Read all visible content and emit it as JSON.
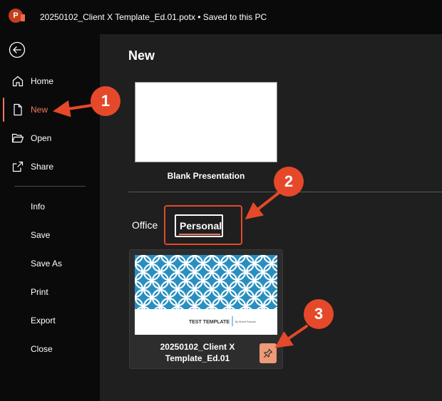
{
  "app": {
    "logo_letter": "P",
    "title": "20250102_Client X Template_Ed.01.potx  •  Saved to this PC"
  },
  "nav": {
    "primary": [
      {
        "label": "Home",
        "icon": "home-icon"
      },
      {
        "label": "New",
        "icon": "new-document-icon",
        "active": true
      },
      {
        "label": "Open",
        "icon": "folder-open-icon"
      },
      {
        "label": "Share",
        "icon": "share-icon"
      }
    ],
    "secondary": [
      "Info",
      "Save",
      "Save As",
      "Print",
      "Export",
      "Close"
    ]
  },
  "main": {
    "title": "New",
    "blank_label": "Blank Presentation",
    "tabs": {
      "office": "Office",
      "personal": "Personal"
    },
    "template": {
      "thumb_title": "TEST TEMPLATE",
      "thumb_sub": "By Sheriff Rowsan",
      "name_line1": "20250102_Client X",
      "name_line2": "Template_Ed.01"
    }
  },
  "callouts": [
    "1",
    "2",
    "3"
  ],
  "colors": {
    "accent": "#ed7a5a",
    "callout": "#e5492a",
    "pattern": "#2a8fbf",
    "pin": "#ed9a78"
  }
}
